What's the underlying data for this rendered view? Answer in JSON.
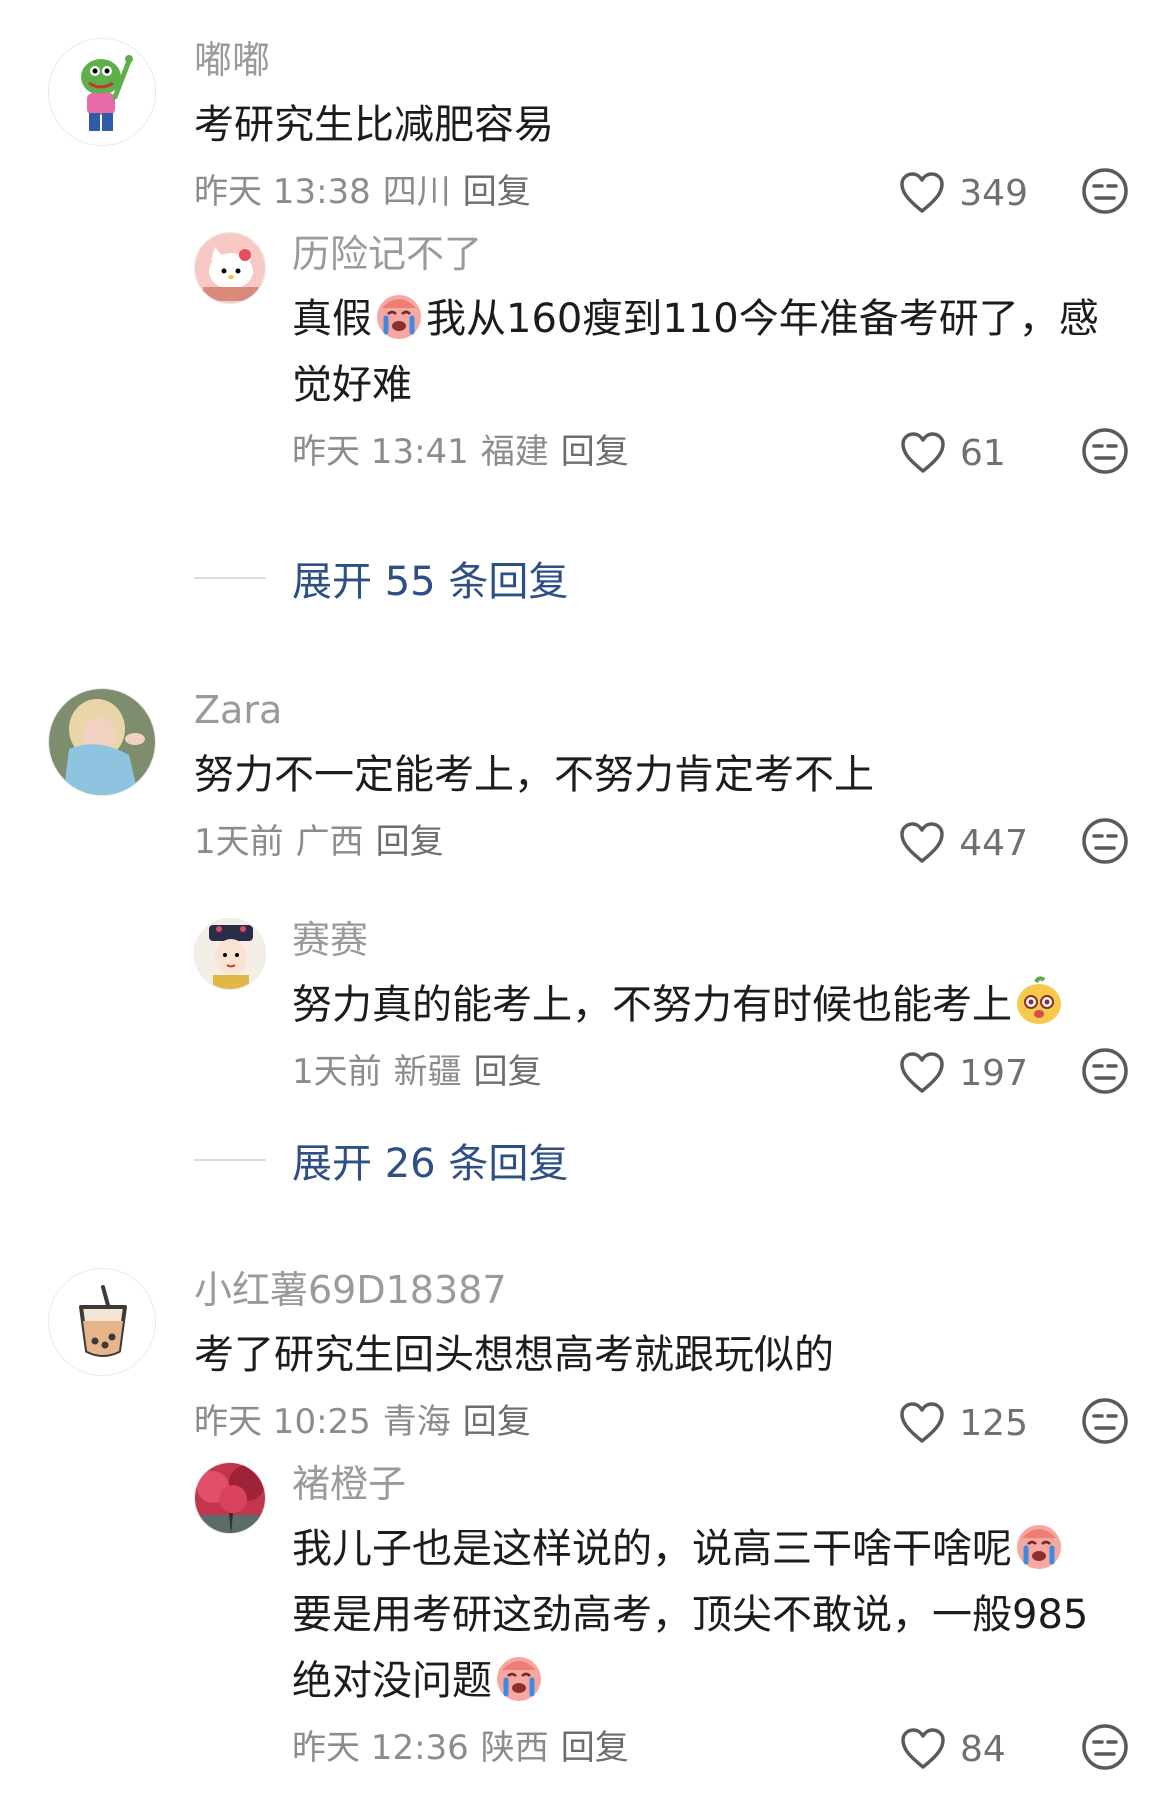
{
  "comments": [
    {
      "author": "嘟嘟",
      "text": "考研究生比减肥容易",
      "time": "昨天 13:38",
      "location": "四川",
      "reply_label": "回复",
      "likes": "349",
      "avatar_icon": "green-frog-avatar",
      "replies": [
        {
          "author": "历险记不了",
          "text": "真假",
          "text_after": "我从160瘦到110今年准备考研了，感觉好难",
          "inline_emoji": "crying-emoji",
          "time": "昨天 13:41",
          "location": "福建",
          "reply_label": "回复",
          "likes": "61",
          "avatar_icon": "hello-kitty-avatar"
        }
      ],
      "expand_label": "展开 55 条回复"
    },
    {
      "author": "Zara",
      "text": "努力不一定能考上，不努力肯定考不上",
      "time": "1天前",
      "location": "广西",
      "reply_label": "回复",
      "likes": "447",
      "avatar_icon": "blonde-girl-avatar",
      "replies": [
        {
          "author": "赛赛",
          "text": "努力真的能考上，不努力有时候也能考上",
          "inline_emoji_end": "yellow-face-emoji",
          "time": "1天前",
          "location": "新疆",
          "reply_label": "回复",
          "likes": "197",
          "avatar_icon": "qing-dynasty-lady-avatar"
        }
      ],
      "expand_label": "展开 26 条回复"
    },
    {
      "author": "小红薯69D18387",
      "text": "考了研究生回头想想高考就跟玩似的",
      "time": "昨天 10:25",
      "location": "青海",
      "reply_label": "回复",
      "likes": "125",
      "avatar_icon": "bubble-tea-avatar",
      "replies": [
        {
          "author": "褚橙子",
          "text_parts": [
            "我儿子也是这样说的，说高三干啥干啥呢",
            "要是用考研这劲高考，顶尖不敢说，一般985绝对没问题"
          ],
          "time": "昨天 12:36",
          "location": "陕西",
          "reply_label": "回复",
          "likes": "84",
          "avatar_icon": "red-trees-avatar"
        }
      ]
    }
  ],
  "colors": {
    "text": "#1c1c1c",
    "meta": "#8c8c8c",
    "author": "#9a9a9a",
    "expand": "#2d4f85"
  },
  "icons": {
    "like": "heart-outline-icon",
    "dislike": "neutral-face-icon"
  }
}
